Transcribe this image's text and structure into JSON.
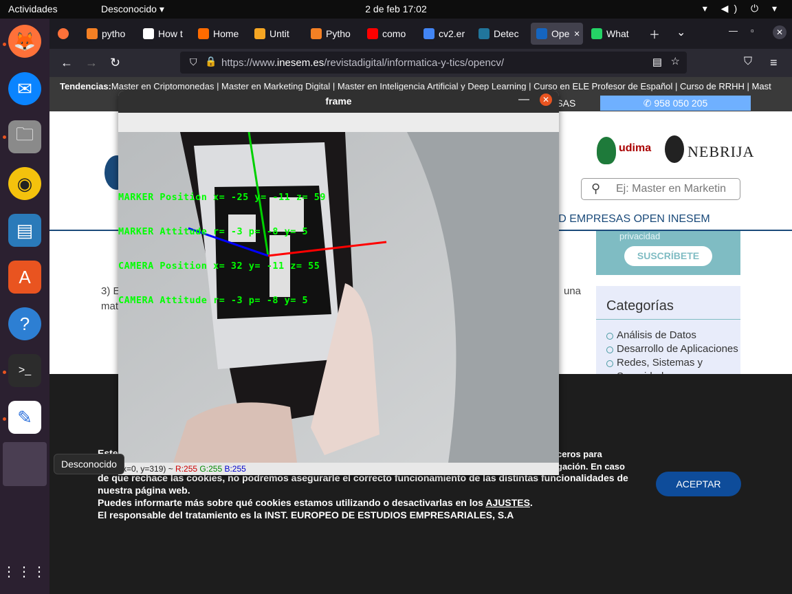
{
  "topbar": {
    "activities": "Actividades",
    "app_name": "Desconocido ▾",
    "clock": "2 de feb  17:02",
    "tray": "▾ ◀) ⏻ ▾"
  },
  "dock": {
    "tooltip": "Desconocido",
    "grid": "⋮⋮⋮"
  },
  "browser": {
    "tabs": [
      {
        "label": "pytho",
        "color": "#f48024"
      },
      {
        "label": "How t",
        "color": "#ffffff"
      },
      {
        "label": "Home",
        "color": "#ff6b00"
      },
      {
        "label": "Untit",
        "color": "#f5a623"
      },
      {
        "label": "Pytho",
        "color": "#f48024"
      },
      {
        "label": "como",
        "color": "#ff0000"
      },
      {
        "label": "cv2.er",
        "color": "#4285f4"
      },
      {
        "label": "Detec",
        "color": "#21759b"
      },
      {
        "label": "Ope",
        "color": "#1565c0"
      },
      {
        "label": "What",
        "color": "#25d366"
      }
    ],
    "url_prefix": "https://www.",
    "url_host": "inesem.es",
    "url_path": "/revistadigital/informatica-y-tics/opencv/"
  },
  "site": {
    "trend_label": "Tendencias:",
    "trend_items": "Master en Criptomonedas | Master en Marketing Digital | Master en Inteligencia Artificial y Deep Learning | Curso en ELE Profesor de Español | Curso de RRHH | Mast",
    "empresas": "ESAS",
    "phone": "958 050 205",
    "udima": "udima",
    "nebrija": "NEBRIJA",
    "search_placeholder": "Ej: Master en Marketin",
    "menu": "DAD   EMPRESAS   OPEN INESEM",
    "privacy": "privacidad",
    "subscribe": "SUSCRÍBETE",
    "categories_title": "Categorías",
    "categories": [
      "Análisis de Datos",
      "Desarrollo de Aplicaciones",
      "Redes, Sistemas y",
      "Seguridad"
    ],
    "article_a": "3) E",
    "article_b": "mat",
    "article_c": "una"
  },
  "cookie": {
    "line1": "Este",
    "line2": "de que rechace las cookies, no podremos asegurarle el correcto funcionamiento de las distintas funcionalidades de",
    "line3": "nuestra página web.",
    "line4a": "Puedes informarte más sobre qué cookies estamos utilizando o desactivarlas en los ",
    "line4b": "AJUSTES",
    "line4c": ".",
    "line5": "El responsable del tratamiento es la INST. EUROPEO DE ESTUDIOS EMPRESARIALES, S.A",
    "right1": "ceros para",
    "right2": "gación. En caso",
    "accept": "ACEPTAR"
  },
  "frame": {
    "title": "frame",
    "overlay": [
      "MARKER Position x= -25  y= -11  z=  59",
      "MARKER Attitude r=  -3  p=  -8  y=   5",
      "CAMERA Position x=  32  y= -11  z=  55",
      "CAMERA Attitude r=  -3  p=  -8  y=   5"
    ],
    "status_pos": "(x=0, y=319) ~ ",
    "status_r": "R:255",
    "status_g": "G:255",
    "status_b": "B:255"
  }
}
